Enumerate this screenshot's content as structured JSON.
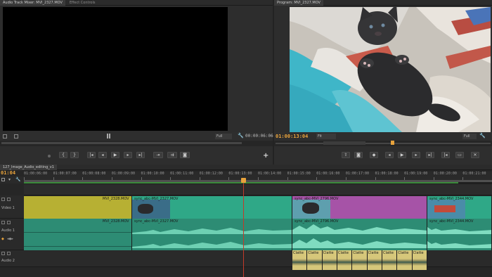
{
  "source_panel": {
    "tabs": [
      "Audio Track Mixer: MVI_2327.MOV",
      "Effect Controls"
    ],
    "fit_label": "Full",
    "timecode": "00:00:06:06"
  },
  "program_panel": {
    "tab": "Program: MVI_2327.MOV",
    "timecode": "01:00:13:04",
    "fit_label": "Fit",
    "quality_label": "Full"
  },
  "sequence": {
    "tab": "127_Image_Audio_editing_v1",
    "timecode": "01:04",
    "ruler_labels": [
      "01:00:06:00",
      "01:00:07:00",
      "01:00:08:00",
      "01:00:09:00",
      "01:00:10:00",
      "01:00:11:00",
      "01:00:12:00",
      "01:00:13:00",
      "01:00:14:00",
      "01:00:15:00",
      "01:00:16:00",
      "01:00:17:00",
      "01:00:18:00",
      "01:00:19:00",
      "01:00:20:00",
      "01:00:21:00"
    ]
  },
  "tracks": {
    "video1": {
      "name": "Video 1"
    },
    "audio1": {
      "name": "Audio 1"
    },
    "audio2": {
      "name": "Audio 2"
    }
  },
  "clips": {
    "v1": [
      "MVI_2328.MOV",
      "sync_abc-MVI_2327.MOV",
      "sync_abc-MVI_2796.MOV",
      "sync_abc-MVI_2344.MOV"
    ],
    "a1": [
      "MVI_2328.MOV",
      "sync_abc-MVI_2327.MOV",
      "sync_abc-MVI_2796.MOV",
      "sync_abc-MVI_2344.MOV"
    ],
    "a2_label": "Clatte"
  },
  "colors": {
    "accent_orange": "#e8a33c",
    "clip_yellow": "#b7b033",
    "clip_teal": "#2fa887",
    "clip_magenta": "#a653a7",
    "clip_audio": "#2d8c74",
    "clip_audio2": "#d6c77a",
    "playhead_red": "#c23a2a"
  }
}
